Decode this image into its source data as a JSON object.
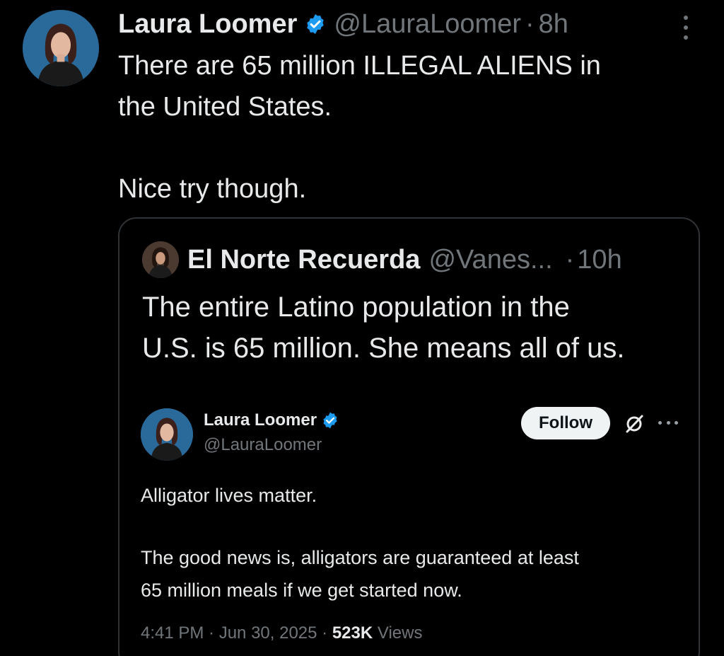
{
  "tweet": {
    "author_name": "Laura Loomer",
    "handle": "@LauraLoomer",
    "separator": "·",
    "time": "8h",
    "body_lines": [
      "There are 65 million ILLEGAL ALIENS in",
      "the United States.",
      "Nice try though."
    ]
  },
  "quote": {
    "author_name": "El Norte Recuerda",
    "handle": "@Vanes...",
    "separator": "·",
    "time": "10h",
    "text_lines": [
      "The entire Latino population in the",
      "U.S. is 65 million. She means all of us."
    ]
  },
  "embedded": {
    "author_name": "Laura Loomer",
    "handle": "@LauraLoomer",
    "follow_label": "Follow",
    "text_lines": [
      "Alligator lives matter.",
      "The good news is, alligators are guaranteed at least",
      "65 million meals if we get started now."
    ],
    "meta_time": "4:41 PM · Jun 30, 2025 · ",
    "views_count": "523K",
    "views_label": " Views"
  },
  "colors": {
    "background": "#000000",
    "text": "#e7e9ea",
    "muted": "#71767b",
    "verified_blue": "#1d9bf0",
    "border": "#2f3336"
  },
  "icons": {
    "verified": "verified-badge-icon",
    "more": "more-vertical-icon",
    "grok": "grok-icon",
    "more_horiz": "more-horizontal-icon"
  }
}
